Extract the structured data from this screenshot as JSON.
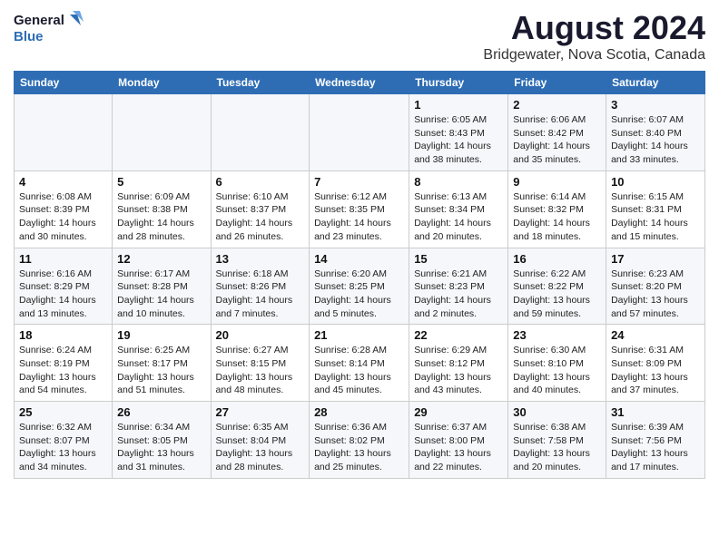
{
  "logo": {
    "line1": "General",
    "line2": "Blue"
  },
  "title": "August 2024",
  "subtitle": "Bridgewater, Nova Scotia, Canada",
  "days_header": [
    "Sunday",
    "Monday",
    "Tuesday",
    "Wednesday",
    "Thursday",
    "Friday",
    "Saturday"
  ],
  "weeks": [
    [
      {
        "day": "",
        "info": ""
      },
      {
        "day": "",
        "info": ""
      },
      {
        "day": "",
        "info": ""
      },
      {
        "day": "",
        "info": ""
      },
      {
        "day": "1",
        "info": "Sunrise: 6:05 AM\nSunset: 8:43 PM\nDaylight: 14 hours\nand 38 minutes."
      },
      {
        "day": "2",
        "info": "Sunrise: 6:06 AM\nSunset: 8:42 PM\nDaylight: 14 hours\nand 35 minutes."
      },
      {
        "day": "3",
        "info": "Sunrise: 6:07 AM\nSunset: 8:40 PM\nDaylight: 14 hours\nand 33 minutes."
      }
    ],
    [
      {
        "day": "4",
        "info": "Sunrise: 6:08 AM\nSunset: 8:39 PM\nDaylight: 14 hours\nand 30 minutes."
      },
      {
        "day": "5",
        "info": "Sunrise: 6:09 AM\nSunset: 8:38 PM\nDaylight: 14 hours\nand 28 minutes."
      },
      {
        "day": "6",
        "info": "Sunrise: 6:10 AM\nSunset: 8:37 PM\nDaylight: 14 hours\nand 26 minutes."
      },
      {
        "day": "7",
        "info": "Sunrise: 6:12 AM\nSunset: 8:35 PM\nDaylight: 14 hours\nand 23 minutes."
      },
      {
        "day": "8",
        "info": "Sunrise: 6:13 AM\nSunset: 8:34 PM\nDaylight: 14 hours\nand 20 minutes."
      },
      {
        "day": "9",
        "info": "Sunrise: 6:14 AM\nSunset: 8:32 PM\nDaylight: 14 hours\nand 18 minutes."
      },
      {
        "day": "10",
        "info": "Sunrise: 6:15 AM\nSunset: 8:31 PM\nDaylight: 14 hours\nand 15 minutes."
      }
    ],
    [
      {
        "day": "11",
        "info": "Sunrise: 6:16 AM\nSunset: 8:29 PM\nDaylight: 14 hours\nand 13 minutes."
      },
      {
        "day": "12",
        "info": "Sunrise: 6:17 AM\nSunset: 8:28 PM\nDaylight: 14 hours\nand 10 minutes."
      },
      {
        "day": "13",
        "info": "Sunrise: 6:18 AM\nSunset: 8:26 PM\nDaylight: 14 hours\nand 7 minutes."
      },
      {
        "day": "14",
        "info": "Sunrise: 6:20 AM\nSunset: 8:25 PM\nDaylight: 14 hours\nand 5 minutes."
      },
      {
        "day": "15",
        "info": "Sunrise: 6:21 AM\nSunset: 8:23 PM\nDaylight: 14 hours\nand 2 minutes."
      },
      {
        "day": "16",
        "info": "Sunrise: 6:22 AM\nSunset: 8:22 PM\nDaylight: 13 hours\nand 59 minutes."
      },
      {
        "day": "17",
        "info": "Sunrise: 6:23 AM\nSunset: 8:20 PM\nDaylight: 13 hours\nand 57 minutes."
      }
    ],
    [
      {
        "day": "18",
        "info": "Sunrise: 6:24 AM\nSunset: 8:19 PM\nDaylight: 13 hours\nand 54 minutes."
      },
      {
        "day": "19",
        "info": "Sunrise: 6:25 AM\nSunset: 8:17 PM\nDaylight: 13 hours\nand 51 minutes."
      },
      {
        "day": "20",
        "info": "Sunrise: 6:27 AM\nSunset: 8:15 PM\nDaylight: 13 hours\nand 48 minutes."
      },
      {
        "day": "21",
        "info": "Sunrise: 6:28 AM\nSunset: 8:14 PM\nDaylight: 13 hours\nand 45 minutes."
      },
      {
        "day": "22",
        "info": "Sunrise: 6:29 AM\nSunset: 8:12 PM\nDaylight: 13 hours\nand 43 minutes."
      },
      {
        "day": "23",
        "info": "Sunrise: 6:30 AM\nSunset: 8:10 PM\nDaylight: 13 hours\nand 40 minutes."
      },
      {
        "day": "24",
        "info": "Sunrise: 6:31 AM\nSunset: 8:09 PM\nDaylight: 13 hours\nand 37 minutes."
      }
    ],
    [
      {
        "day": "25",
        "info": "Sunrise: 6:32 AM\nSunset: 8:07 PM\nDaylight: 13 hours\nand 34 minutes."
      },
      {
        "day": "26",
        "info": "Sunrise: 6:34 AM\nSunset: 8:05 PM\nDaylight: 13 hours\nand 31 minutes."
      },
      {
        "day": "27",
        "info": "Sunrise: 6:35 AM\nSunset: 8:04 PM\nDaylight: 13 hours\nand 28 minutes."
      },
      {
        "day": "28",
        "info": "Sunrise: 6:36 AM\nSunset: 8:02 PM\nDaylight: 13 hours\nand 25 minutes."
      },
      {
        "day": "29",
        "info": "Sunrise: 6:37 AM\nSunset: 8:00 PM\nDaylight: 13 hours\nand 22 minutes."
      },
      {
        "day": "30",
        "info": "Sunrise: 6:38 AM\nSunset: 7:58 PM\nDaylight: 13 hours\nand 20 minutes."
      },
      {
        "day": "31",
        "info": "Sunrise: 6:39 AM\nSunset: 7:56 PM\nDaylight: 13 hours\nand 17 minutes."
      }
    ]
  ]
}
